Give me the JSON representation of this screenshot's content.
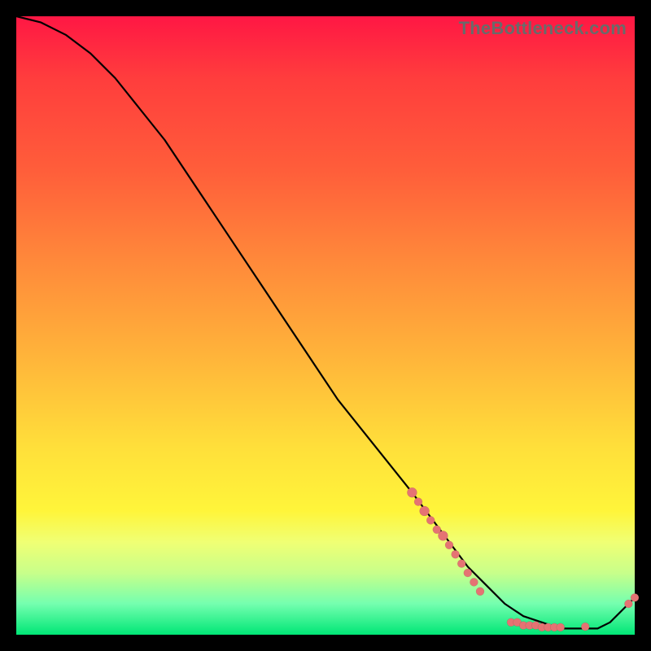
{
  "watermark": "TheBottleneck.com",
  "chart_data": {
    "type": "line",
    "title": "",
    "xlabel": "",
    "ylabel": "",
    "xlim": [
      0,
      100
    ],
    "ylim": [
      0,
      100
    ],
    "grid": false,
    "legend": false,
    "series": [
      {
        "name": "curve",
        "x": [
          0,
          4,
          8,
          12,
          16,
          20,
          24,
          28,
          32,
          36,
          40,
          44,
          48,
          52,
          56,
          60,
          64,
          67,
          70,
          73,
          76,
          79,
          82,
          85,
          88,
          90,
          92,
          94,
          96,
          98,
          100
        ],
        "y": [
          100,
          99,
          97,
          94,
          90,
          85,
          80,
          74,
          68,
          62,
          56,
          50,
          44,
          38,
          33,
          28,
          23,
          19,
          15,
          11,
          8,
          5,
          3,
          2,
          1,
          1,
          1,
          1,
          2,
          4,
          6
        ]
      }
    ],
    "points": {
      "name": "markers",
      "color": "#e57373",
      "data": [
        {
          "x": 64,
          "y": 23,
          "r": 6
        },
        {
          "x": 65,
          "y": 21.5,
          "r": 5
        },
        {
          "x": 66,
          "y": 20,
          "r": 6
        },
        {
          "x": 67,
          "y": 18.5,
          "r": 5
        },
        {
          "x": 68,
          "y": 17,
          "r": 5
        },
        {
          "x": 69,
          "y": 16,
          "r": 6
        },
        {
          "x": 70,
          "y": 14.5,
          "r": 5
        },
        {
          "x": 71,
          "y": 13,
          "r": 5
        },
        {
          "x": 72,
          "y": 11.5,
          "r": 5
        },
        {
          "x": 73,
          "y": 10,
          "r": 5
        },
        {
          "x": 74,
          "y": 8.5,
          "r": 5
        },
        {
          "x": 75,
          "y": 7,
          "r": 5
        },
        {
          "x": 80,
          "y": 2,
          "r": 5
        },
        {
          "x": 81,
          "y": 2,
          "r": 5
        },
        {
          "x": 82,
          "y": 1.5,
          "r": 5
        },
        {
          "x": 83,
          "y": 1.5,
          "r": 5
        },
        {
          "x": 84,
          "y": 1.5,
          "r": 5
        },
        {
          "x": 85,
          "y": 1.2,
          "r": 5
        },
        {
          "x": 86,
          "y": 1.2,
          "r": 5
        },
        {
          "x": 87,
          "y": 1.2,
          "r": 5
        },
        {
          "x": 88,
          "y": 1.2,
          "r": 5
        },
        {
          "x": 92,
          "y": 1.3,
          "r": 5
        },
        {
          "x": 99,
          "y": 5,
          "r": 5
        },
        {
          "x": 100,
          "y": 6,
          "r": 5
        }
      ]
    }
  }
}
